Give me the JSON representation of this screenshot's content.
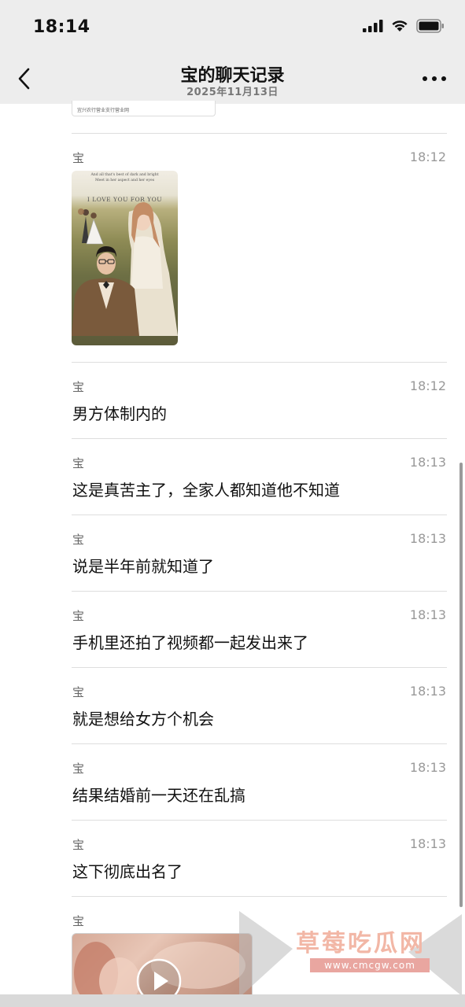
{
  "status_bar": {
    "time": "18:14"
  },
  "nav": {
    "title": "宝的聊天记录",
    "subtitle": "2025年11月13日"
  },
  "card_peek": {
    "text": "宜兴农行营业支行营业网"
  },
  "photo": {
    "caption_line1": "And all that's best of dark and bright",
    "caption_line2": "Meet in her aspect and her eyes",
    "caption_main": "I LOVE YOU FOR YOU"
  },
  "messages": [
    {
      "sender": "宝",
      "time": "18:12",
      "type": "image"
    },
    {
      "sender": "宝",
      "time": "18:12",
      "text": "男方体制内的"
    },
    {
      "sender": "宝",
      "time": "18:13",
      "text": "这是真苦主了，全家人都知道他不知道"
    },
    {
      "sender": "宝",
      "time": "18:13",
      "text": "说是半年前就知道了"
    },
    {
      "sender": "宝",
      "time": "18:13",
      "text": "手机里还拍了视频都一起发出来了"
    },
    {
      "sender": "宝",
      "time": "18:13",
      "text": "就是想给女方个机会"
    },
    {
      "sender": "宝",
      "time": "18:13",
      "text": "结果结婚前一天还在乱搞"
    },
    {
      "sender": "宝",
      "time": "18:13",
      "text": "这下彻底出名了"
    },
    {
      "sender": "宝",
      "type": "video"
    }
  ],
  "watermark": {
    "title": "草莓吃瓜网",
    "url": "www.cmcgw.com"
  },
  "icons": {
    "back": "chevron-left-icon",
    "more": "more-dots-icon",
    "signal": "signal-icon",
    "wifi": "wifi-icon",
    "battery": "battery-icon",
    "play": "play-icon"
  }
}
